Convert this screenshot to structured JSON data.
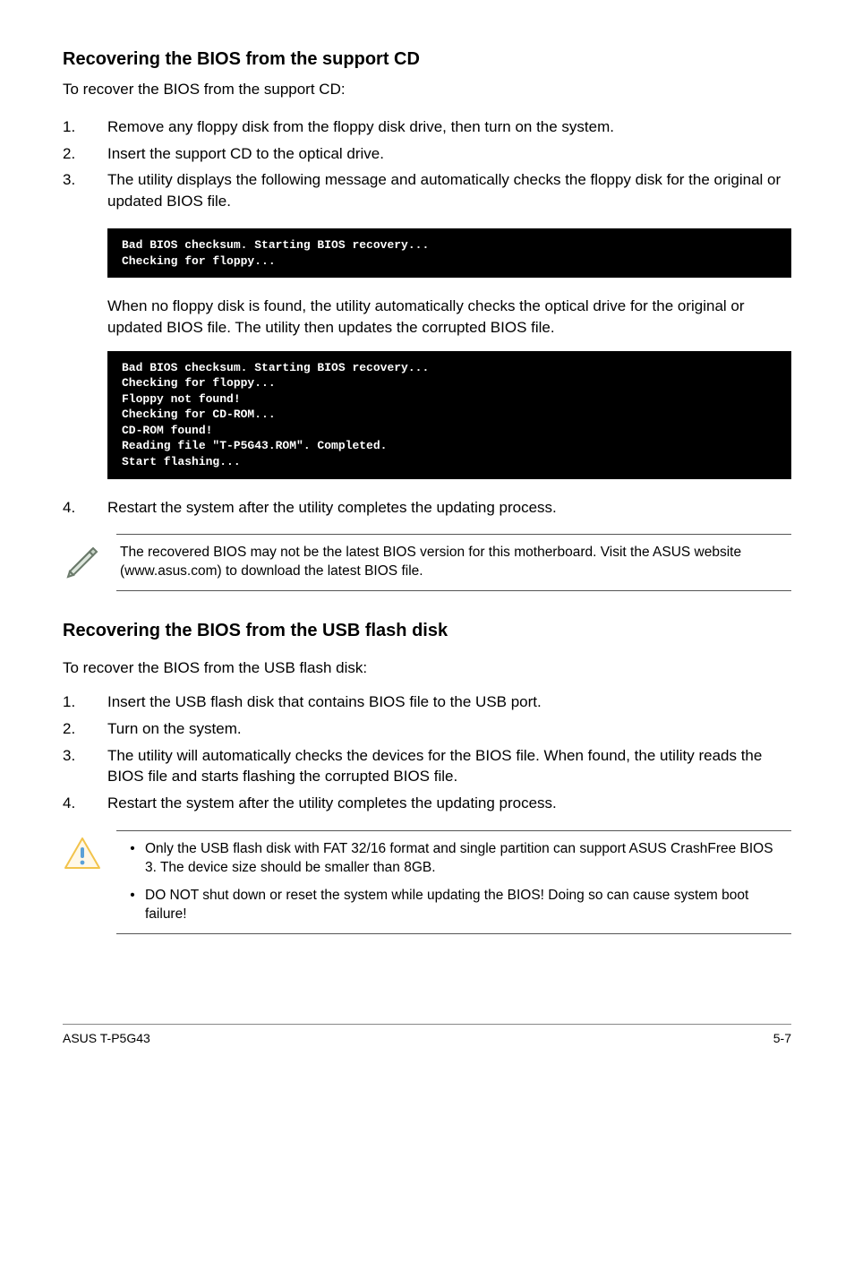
{
  "section1": {
    "heading": "Recovering the BIOS from the support CD",
    "intro": "To recover the BIOS from the support CD:",
    "steps": [
      {
        "n": "1.",
        "t": "Remove any floppy disk from the floppy disk drive, then turn on the system."
      },
      {
        "n": "2.",
        "t": "Insert the support CD to the optical drive."
      },
      {
        "n": "3.",
        "t": "The utility displays the following message and automatically checks the floppy disk for the original or updated BIOS file."
      }
    ],
    "code1": "Bad BIOS checksum. Starting BIOS recovery...\nChecking for floppy...",
    "mid_para": "When no floppy disk is found, the utility automatically checks the optical drive for the original or updated BIOS file. The utility then updates the corrupted BIOS file.",
    "code2": "Bad BIOS checksum. Starting BIOS recovery...\nChecking for floppy...\nFloppy not found!\nChecking for CD-ROM...\nCD-ROM found!\nReading file \"T-P5G43.ROM\". Completed.\nStart flashing...",
    "step4": {
      "n": " 4.",
      "t": "Restart the system after the utility completes the updating process."
    },
    "note": "The recovered BIOS may not be the latest BIOS version for this motherboard. Visit the ASUS website (www.asus.com) to download the latest BIOS file."
  },
  "section2": {
    "heading": "Recovering the BIOS from the USB flash disk",
    "intro": "To recover the BIOS from the USB flash disk:",
    "steps": [
      {
        "n": "1.",
        "t": "Insert the USB flash disk that contains BIOS file to the USB port."
      },
      {
        "n": "2.",
        "t": "Turn on the system."
      },
      {
        "n": "3.",
        "t": "The utility will automatically checks the devices for the BIOS file. When found, the utility reads the BIOS file and starts flashing the corrupted BIOS file."
      },
      {
        "n": "4.",
        "t": "Restart the system after the utility completes the updating process."
      }
    ],
    "warnings": [
      "Only the USB flash disk with FAT 32/16 format and single partition can support ASUS CrashFree BIOS 3. The device size should be smaller than 8GB.",
      "DO NOT shut down or reset the system while updating the BIOS! Doing so can cause system boot failure!"
    ]
  },
  "footer": {
    "left": "ASUS T-P5G43",
    "right": "5-7"
  }
}
